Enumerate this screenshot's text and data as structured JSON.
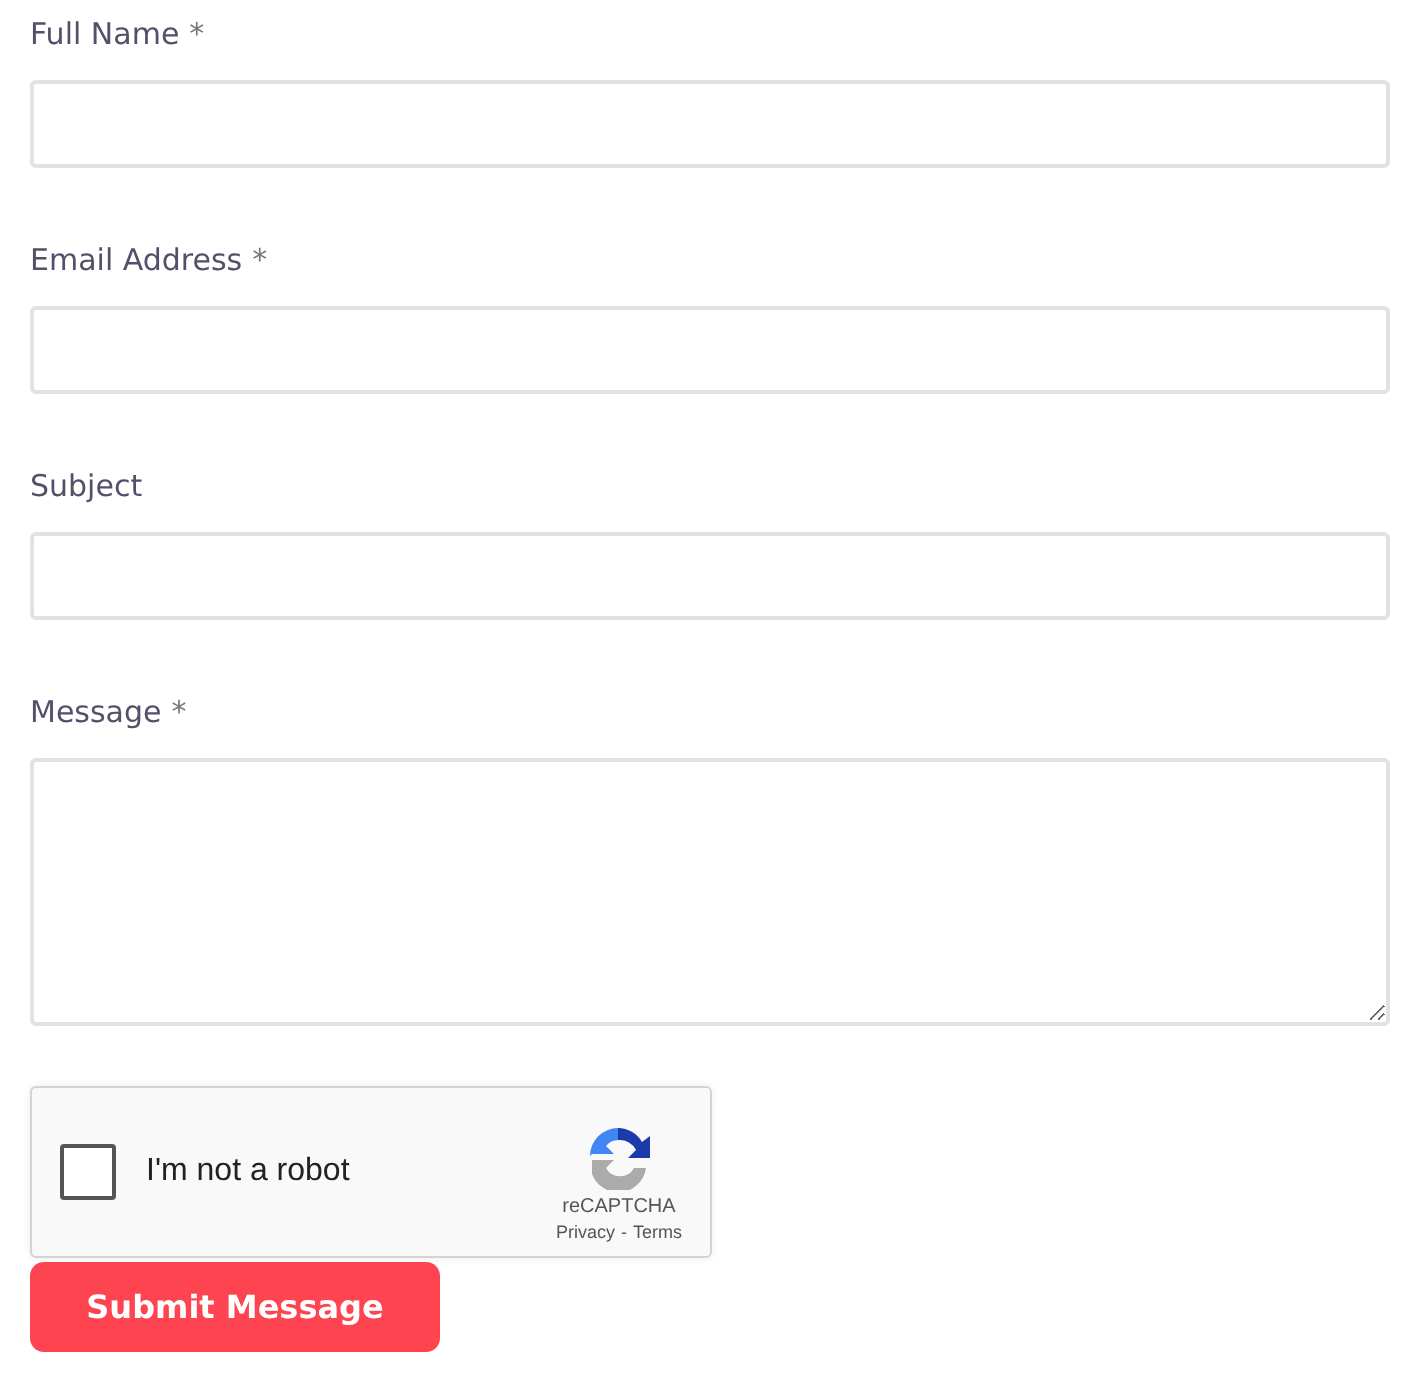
{
  "fields": [
    {
      "label": "Full Name",
      "required_mark": "*",
      "kind": "input"
    },
    {
      "label": "Email Address",
      "required_mark": "*",
      "kind": "input"
    },
    {
      "label": "Subject",
      "kind": "input"
    },
    {
      "label": "Message",
      "required_mark": "*",
      "kind": "textarea"
    }
  ],
  "captcha": {
    "label": "I'm not a robot",
    "checked": false,
    "brand": "reCAPTCHA",
    "privacy": "Privacy",
    "separator": "-",
    "terms": "Terms"
  },
  "submit": "Submit Message"
}
